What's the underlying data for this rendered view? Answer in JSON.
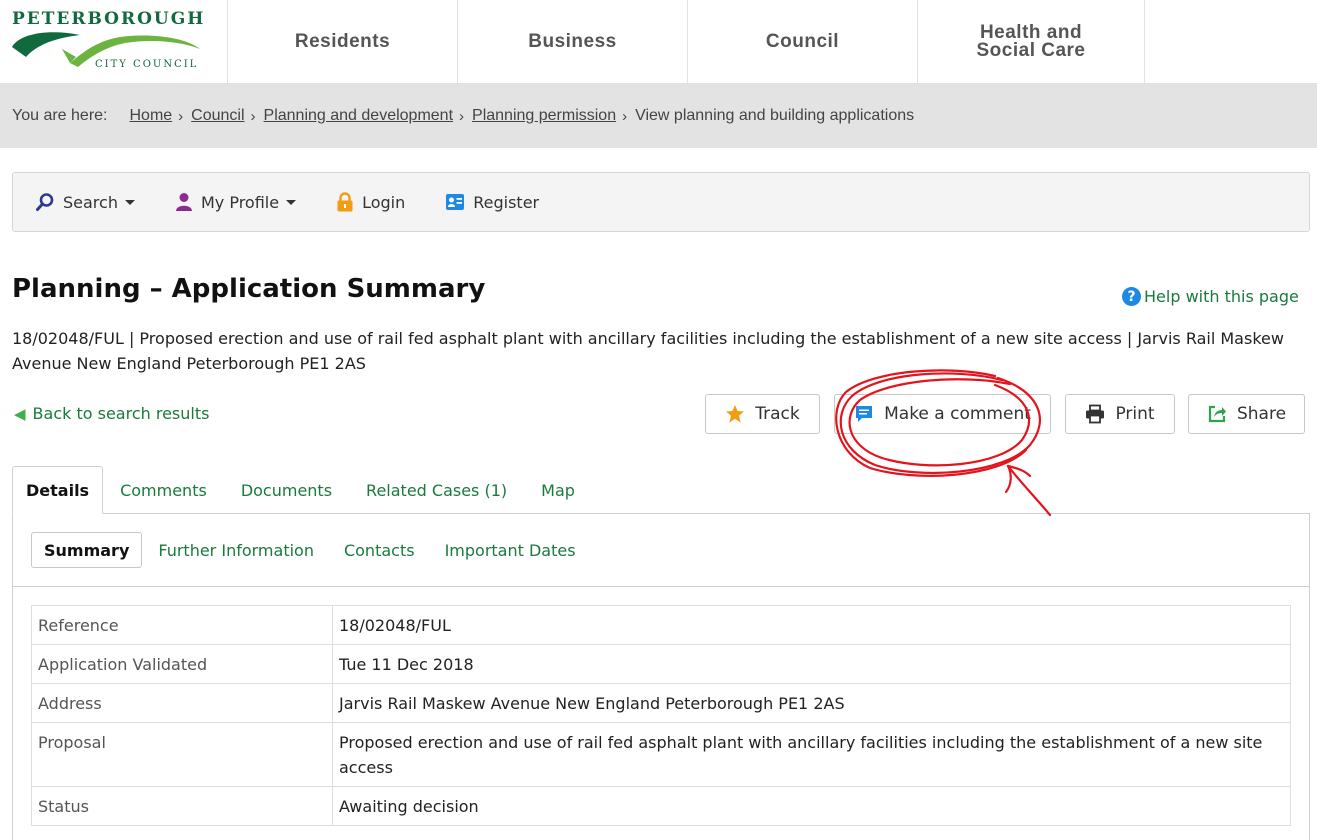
{
  "logo": {
    "top_text": "PETERBOROUGH",
    "bottom_text": "CITY COUNCIL"
  },
  "main_nav": [
    {
      "label": "Residents"
    },
    {
      "label": "Business"
    },
    {
      "label": "Council"
    },
    {
      "label_line1": "Health and",
      "label_line2": "Social Care"
    }
  ],
  "breadcrumb": {
    "label": "You are here:",
    "items": [
      "Home",
      "Council",
      "Planning and development",
      "Planning permission"
    ],
    "current": "View planning and building applications"
  },
  "util_bar": {
    "search": "Search",
    "profile": "My Profile",
    "login": "Login",
    "register": "Register"
  },
  "page": {
    "title_bold": "Planning",
    "title_rest": " – Application Summary",
    "help": "Help with this page",
    "description": "18/02048/FUL | Proposed erection and use of rail fed asphalt plant with ancillary facilities including the establishment of a new site access | Jarvis Rail Maskew Avenue New England Peterborough PE1 2AS",
    "back": "Back to search results"
  },
  "actions": {
    "track": "Track",
    "comment": "Make a comment",
    "print": "Print",
    "share": "Share"
  },
  "tabs": [
    "Details",
    "Comments",
    "Documents",
    "Related Cases (1)",
    "Map"
  ],
  "subtabs": [
    "Summary",
    "Further Information",
    "Contacts",
    "Important Dates"
  ],
  "summary": {
    "rows": [
      {
        "label": "Reference",
        "value": "18/02048/FUL"
      },
      {
        "label": "Application Validated",
        "value": "Tue 11 Dec 2018"
      },
      {
        "label": "Address",
        "value": "Jarvis Rail Maskew Avenue New England Peterborough PE1 2AS"
      },
      {
        "label": "Proposal",
        "value": "Proposed erection and use of rail fed asphalt plant with ancillary facilities including the establishment of a new site access"
      },
      {
        "label": "Status",
        "value": "Awaiting decision"
      }
    ]
  },
  "colors": {
    "link_green": "#1a7a3c",
    "brand_green": "#116a3d",
    "annotation_red": "#e3141c"
  }
}
